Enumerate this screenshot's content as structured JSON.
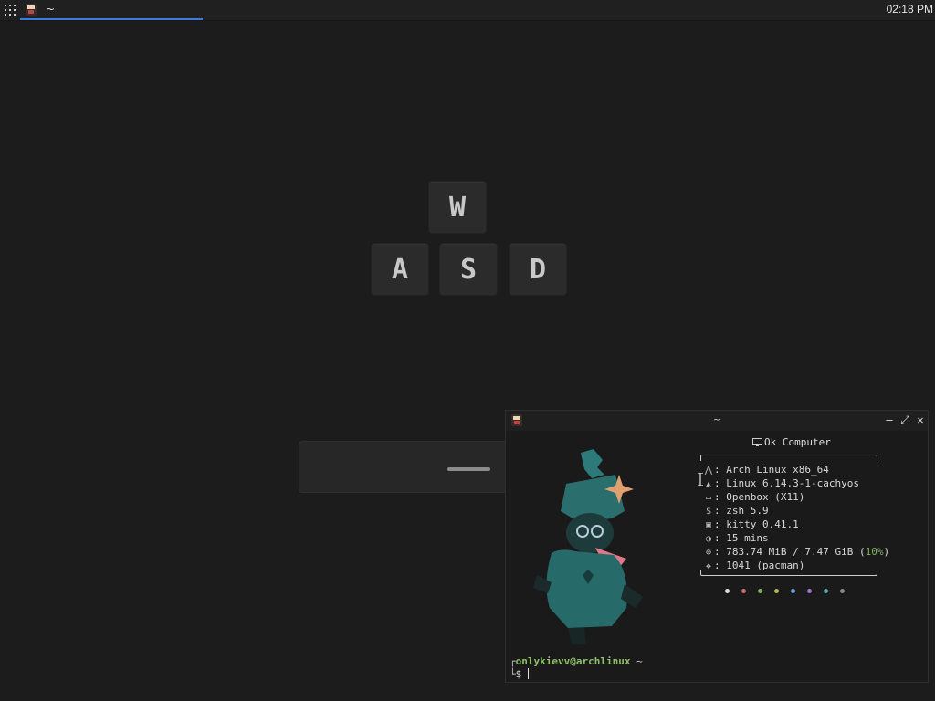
{
  "topbar": {
    "task_label": "~",
    "clock": "02:18 PM"
  },
  "keys": {
    "w": "W",
    "a": "A",
    "s": "S",
    "d": "D"
  },
  "terminal": {
    "title": "~",
    "buttons": {
      "minimize": "—",
      "maximize": "⤢",
      "close": "✕"
    },
    "host_label": "Ok Computer",
    "info": [
      {
        "icon": "arch-icon",
        "glyph": "⋀",
        "text": ": Arch Linux x86_64"
      },
      {
        "icon": "linux-icon",
        "glyph": "◭",
        "text": ": Linux 6.14.3-1-cachyos"
      },
      {
        "icon": "window-icon",
        "glyph": "▭",
        "text": ": Openbox (X11)"
      },
      {
        "icon": "dollar-icon",
        "glyph": "$",
        "text": ": zsh 5.9"
      },
      {
        "icon": "terminal-icon",
        "glyph": "▣",
        "text": ": kitty 0.41.1"
      },
      {
        "icon": "clock-icon",
        "glyph": "◑",
        "text": ": 15 mins"
      },
      {
        "icon": "memory-icon",
        "glyph": "⊕",
        "text": ": 783.74 MiB / 7.47 GiB ("
      },
      {
        "icon": "package-icon",
        "glyph": "❖",
        "text": ": 1041 (pacman)"
      }
    ],
    "memory_percent": "10%",
    "memory_close": ")",
    "color_dots": [
      "#e0e0e0",
      "#d26b6b",
      "#7fae62",
      "#b6b65a",
      "#6f9ed8",
      "#9a7cc6",
      "#5fa8a0",
      "#8a8a8a"
    ],
    "prompt_user": "onlykievv@archlinux",
    "prompt_dir": "~",
    "prompt_symbol": "$"
  },
  "colors": {
    "accent": "#3d7be0",
    "background": "#1c1c1c",
    "prompt_green": "#8fbf6a"
  }
}
